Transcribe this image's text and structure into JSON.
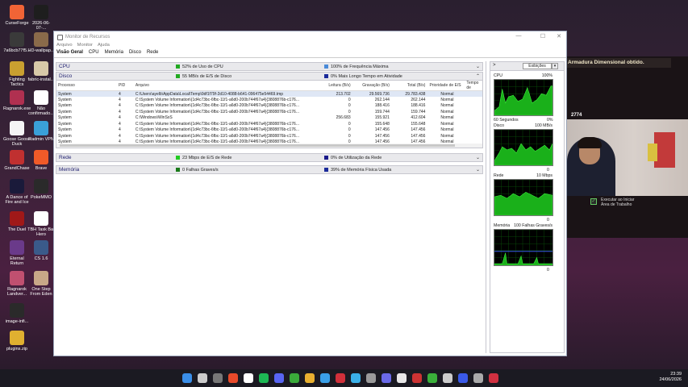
{
  "desktop": {
    "icons": [
      {
        "label": "CurseForge",
        "color": "#f16436"
      },
      {
        "label": "2026-06-07-...",
        "color": "#1e1e1e"
      },
      {
        "label": "7a6bcb77f5...",
        "color": "#3a3a3a"
      },
      {
        "label": "HD-wallpap...",
        "color": "#8a6a4a"
      },
      {
        "label": "Fighting Tactics",
        "color": "#c9a030"
      },
      {
        "label": "fabric-instal...",
        "color": "#d8c9a8"
      },
      {
        "label": "Ragnarok.exe",
        "color": "#b03050"
      },
      {
        "label": "Não confirmado...",
        "color": "#ffffff"
      },
      {
        "label": "Goose Goose Duck",
        "color": "#f5f5f5"
      },
      {
        "label": "Radmin VPN",
        "color": "#3aa0d8"
      },
      {
        "label": "GrandChase",
        "color": "#c03030"
      },
      {
        "label": "Brave",
        "color": "#f05a28"
      },
      {
        "label": "A Dance of Fire and Ice",
        "color": "#1a1a3a"
      },
      {
        "label": "PokeMMO",
        "color": "#2a2a2a"
      },
      {
        "label": "The Duel",
        "color": "#a01818"
      },
      {
        "label": "TBH Task Bar Hero",
        "color": "#ffffff"
      },
      {
        "label": "Eternal Return",
        "color": "#6a3a8a"
      },
      {
        "label": "CS 1.6",
        "color": "#3a5a8a"
      },
      {
        "label": "Ragnarok Landver...",
        "color": "#c05070"
      },
      {
        "label": "One Step From Eden",
        "color": "#c8a888"
      },
      {
        "label": "image-infi...",
        "color": "#2a2a2a"
      },
      {
        "label": "plugins.zip",
        "color": "#e0b030"
      }
    ]
  },
  "game_overlay": {
    "banner": "Armadura Dimensional obtido.",
    "score": "2774"
  },
  "window": {
    "title": "Monitor de Recursos",
    "menu": [
      "Arquivo",
      "Monitor",
      "Ajuda"
    ],
    "tabs": [
      "Visão Geral",
      "CPU",
      "Memória",
      "Disco",
      "Rede"
    ],
    "controls": [
      "—",
      "☐",
      "✕"
    ]
  },
  "sections": {
    "cpu": {
      "name": "CPU",
      "s1": "52% de Uso de CPU",
      "s1_color": "#22aa22",
      "s2": "100% de Frequência Máxima",
      "s2_color": "#4a8ad8"
    },
    "disco": {
      "name": "Disco",
      "s1": "55 MB/s de E/S de Disco",
      "s1_color": "#22aa22",
      "s2": "0% Mais Longo Tempo em Atividade",
      "s2_color": "#1a2a9a"
    },
    "rede": {
      "name": "Rede",
      "s1": "23 Mbps de E/S de Rede",
      "s1_color": "#22cc22",
      "s2": "0% de Utilização da Rede",
      "s2_color": "#1a1a8a"
    },
    "memoria": {
      "name": "Memória",
      "s1": "0 Falhas Graves/s",
      "s1_color": "#1a7a1a",
      "s2": "39% de Memória Física Usada",
      "s2_color": "#1a2a9a"
    }
  },
  "disk_table": {
    "headers": [
      "Processo",
      "PID",
      "Arquivo",
      "Leitura (B/s)",
      "Gravação (B/s)",
      "Total (B/s)",
      "Prioridade de E/S",
      "Tempo de"
    ],
    "rows": [
      [
        "System",
        "4",
        "C:\\Users\\ayelb\\AppData\\Local\\Temp\\9df1f79f-2d10-4088-b641-096475e54469.tmp",
        "213.702",
        "29.569.736",
        "29.783.438",
        "Normal",
        ""
      ],
      [
        "System",
        "4",
        "C:\\System Volume Information\\{1d4c73bc-6fbc-11f1-a6d0-200b744f67a4}{3808876b-c176...",
        "0",
        "262.144",
        "262.144",
        "Normal",
        ""
      ],
      [
        "System",
        "4",
        "C:\\System Volume Information\\{1d4c73bc-6fbc-11f1-a6d0-200b744f67a4}{3808876b-c176...",
        "0",
        "188.416",
        "188.416",
        "Normal",
        ""
      ],
      [
        "System",
        "4",
        "C:\\System Volume Information\\{1d4c73bc-6fbc-11f1-a6d0-200b744f67a4}{3808876b-c176...",
        "0",
        "159.744",
        "159.744",
        "Normal",
        ""
      ],
      [
        "System",
        "4",
        "C:\\Windows\\WinSxS",
        "256.683",
        "155.921",
        "412.604",
        "Normal",
        ""
      ],
      [
        "System",
        "4",
        "C:\\System Volume Information\\{1d4c73bc-6fbc-11f1-a6d0-200b744f67a4}{3808876b-c176...",
        "0",
        "155.648",
        "155.648",
        "Normal",
        ""
      ],
      [
        "System",
        "4",
        "C:\\System Volume Information\\{1d4c73bc-6fbc-11f1-a6d0-200b744f67a4}{3808876b-c176...",
        "0",
        "147.456",
        "147.456",
        "Normal",
        ""
      ],
      [
        "System",
        "4",
        "C:\\System Volume Information\\{1d4c73bc-6fbc-11f1-a6d0-200b744f67a4}{3808876b-c176...",
        "0",
        "147.456",
        "147.456",
        "Normal",
        ""
      ],
      [
        "System",
        "4",
        "C:\\System Volume Information\\{1d4c73bc-6fbc-11f1-a6d0-200b744f67a4}{3808876b-c176...",
        "0",
        "147.456",
        "147.456",
        "Normal",
        ""
      ]
    ]
  },
  "right_pane": {
    "view_button": "Exibições",
    "dropdown": "▾",
    "expand": ">",
    "graphs": [
      {
        "name": "CPU",
        "max": "100%",
        "footer_left": "60 Segundos",
        "footer_right": "0%"
      },
      {
        "name": "Disco",
        "max": "100 MB/s",
        "footer_left": "",
        "footer_right": "0"
      },
      {
        "name": "Rede",
        "max": "10 Mbps",
        "footer_left": "",
        "footer_right": "0"
      },
      {
        "name": "Memória",
        "max": "100 Falhas Graves/s",
        "footer_left": "",
        "footer_right": "0"
      }
    ]
  },
  "webcam_overlay": {
    "checkbox_label": "Executar ao Iniciar Área de Trabalho"
  },
  "taskbar": {
    "time": "23:39",
    "date": "24/06/2026"
  }
}
